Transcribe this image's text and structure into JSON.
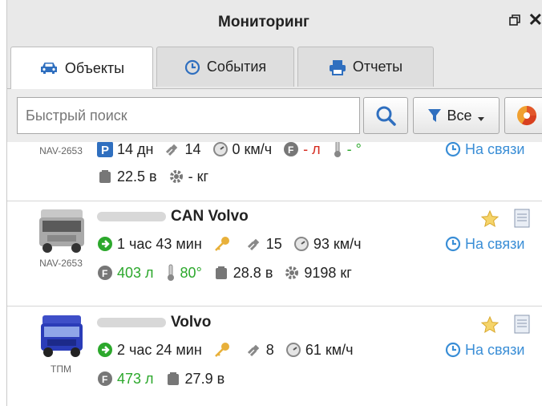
{
  "window": {
    "title": "Мониторинг"
  },
  "tabs": [
    {
      "label": "Объекты",
      "icon": "car-icon",
      "active": true
    },
    {
      "label": "События",
      "icon": "clock-icon",
      "active": false
    },
    {
      "label": "Отчеты",
      "icon": "printer-icon",
      "active": false
    }
  ],
  "toolbar": {
    "search_placeholder": "Быстрый поиск",
    "filter_label": "Все"
  },
  "colors": {
    "accent": "#3a8ed6",
    "green": "#2ca82c",
    "red": "#d52a1f"
  },
  "vehicles": [
    {
      "plate": "NAV-2653",
      "line1": {
        "parking": "14 дн",
        "satellites": "14",
        "speed": "0 км/ч",
        "fuel": "- л",
        "temp": "- °"
      },
      "line2": {
        "voltage": "22.5 в",
        "weight": "- кг"
      },
      "status": "На связи"
    },
    {
      "name": "CAN Volvo",
      "plate": "NAV-2653",
      "line1": {
        "duration": "1 час 43 мин",
        "satellites": "15",
        "speed": "93 км/ч"
      },
      "line2": {
        "fuel": "403 л",
        "temp": "80°",
        "voltage": "28.8 в",
        "weight": "9198 кг"
      },
      "status": "На связи"
    },
    {
      "name": "Volvo",
      "plate": "ТПМ",
      "line1": {
        "duration": "2 час 24 мин",
        "satellites": "8",
        "speed": "61 км/ч"
      },
      "line2": {
        "fuel": "473 л",
        "voltage": "27.9 в"
      },
      "status": "На связи"
    }
  ]
}
